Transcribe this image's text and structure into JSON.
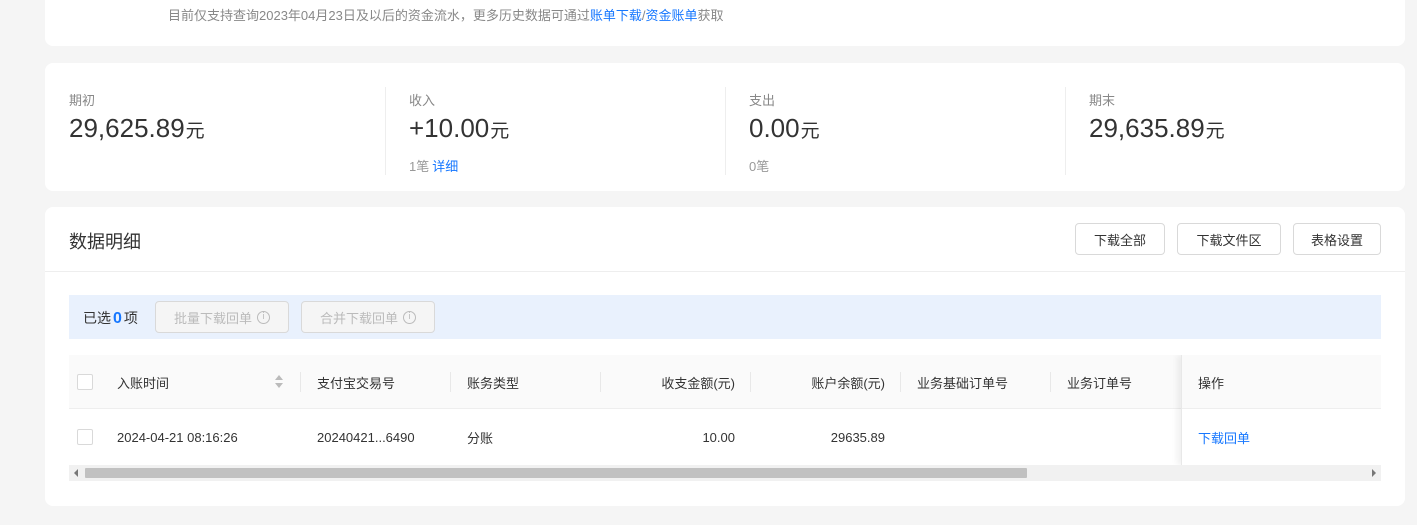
{
  "notice": {
    "prefix": "目前仅支持查询2023年04月23日及以后的资金流水，更多历史数据可通过",
    "link1": "账单下载",
    "separator": "/",
    "link2": "资金账单",
    "suffix": "获取"
  },
  "summary": [
    {
      "label": "期初",
      "amount": "29,625.89",
      "unit": "元",
      "sub_count": "",
      "sub_link": ""
    },
    {
      "label": "收入",
      "amount": "+10.00",
      "unit": "元",
      "sub_count": "1笔",
      "sub_link": "详细"
    },
    {
      "label": "支出",
      "amount": "0.00",
      "unit": "元",
      "sub_count": "0笔",
      "sub_link": ""
    },
    {
      "label": "期末",
      "amount": "29,635.89",
      "unit": "元",
      "sub_count": "",
      "sub_link": ""
    }
  ],
  "detail": {
    "title": "数据明细",
    "buttons": {
      "download_all": "下载全部",
      "download_files": "下载文件区",
      "table_settings": "表格设置"
    }
  },
  "select_bar": {
    "prefix": "已选",
    "count": "0",
    "suffix": "项",
    "batch_download": "批量下载回单",
    "merge_download": "合并下载回单",
    "info_icon": "ⓘ"
  },
  "table": {
    "columns": [
      "入账时间",
      "支付宝交易号",
      "账务类型",
      "收支金额(元)",
      "账户余额(元)",
      "业务基础订单号",
      "业务订单号",
      "操作"
    ],
    "rows": [
      {
        "time": "2024-04-21 08:16:26",
        "trade_no": "20240421...6490",
        "type": "分账",
        "amount": "10.00",
        "balance": "29635.89",
        "base_order": "",
        "order": "",
        "action": "下载回单"
      }
    ]
  },
  "colors": {
    "accent": "#1677ff",
    "select_bar_bg": "#e9f1fd",
    "page_bg": "#f5f5f5"
  }
}
